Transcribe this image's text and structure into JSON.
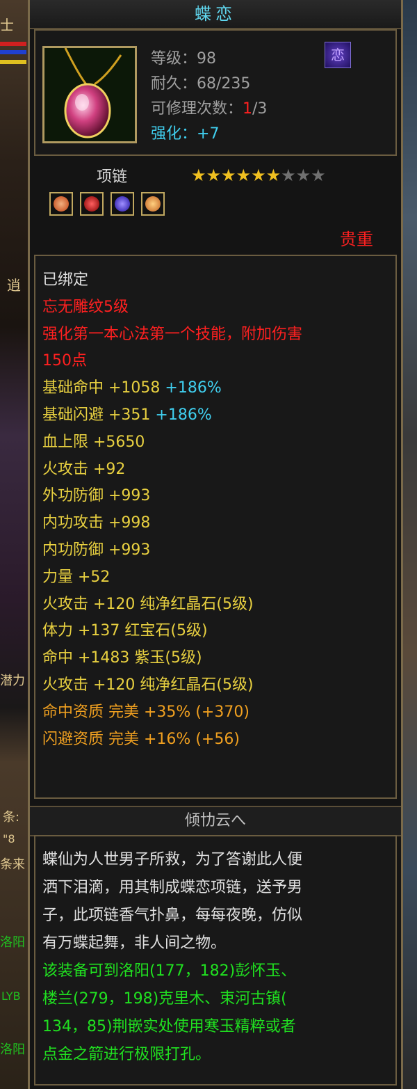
{
  "item": {
    "name": "蝶恋",
    "level_label": "等级：",
    "level": "98",
    "durability_label": "耐久：",
    "durability": "68/235",
    "repair_label": "可修理次数：",
    "repair_used": "1",
    "repair_total": "/3",
    "enhance_label": "强化：",
    "enhance_value": "+7",
    "badge_glyph": "恋",
    "type": "项链",
    "stars_filled": 6,
    "stars_total": 9,
    "rarity": "贵重",
    "gem_colors": [
      "#e06020",
      "#c01010",
      "#5040d0",
      "#f0a030"
    ]
  },
  "attributes": {
    "bound": "已绑定",
    "engrave": "忘无雕纹5级",
    "engrave_effect_1": "强化第一本心法第一个技能，附加伤害",
    "engrave_effect_2": "150点",
    "hit_label": "基础命中 +1058 ",
    "hit_pct": "+186%",
    "dodge_label": "基础闪避 +351 ",
    "dodge_pct": "+186%",
    "lines": [
      "血上限 +5650",
      "火攻击 +92",
      "外功防御 +993",
      "内功攻击 +998",
      "内功防御 +993",
      "力量 +52",
      "火攻击 +120 纯净红晶石(5级)",
      "体力 +137 红宝石(5级)",
      "命中 +1483 紫玉(5级)",
      "火攻击 +120 纯净红晶石(5级)"
    ],
    "hit_aptitude": "命中资质  完美 +35% (+370)",
    "dodge_aptitude": "闪避资质  完美 +16% (+56)"
  },
  "description": {
    "section_title": "倾㔹云へ",
    "lore": [
      "蝶仙为人世男子所救，为了答谢此人便",
      "洒下泪滴，用其制成蝶恋项链，送予男",
      "子，此项链香气扑鼻，每每夜晚，仿似",
      "有万蝶起舞，非人间之物。"
    ],
    "hint": [
      "该装备可到洛阳(177，182)彭怀玉、",
      "楼兰(279，198)克里木、束河古镇(",
      "134，85)荆嵌实处使用寒玉精粹或者",
      "点金之箭进行极限打孔。"
    ]
  },
  "background": {
    "left_texts": [
      "士",
      "逍",
      "潜力",
      "条:",
      "\"8",
      "条来",
      "洛阳",
      "LYB",
      "洛阳"
    ]
  }
}
